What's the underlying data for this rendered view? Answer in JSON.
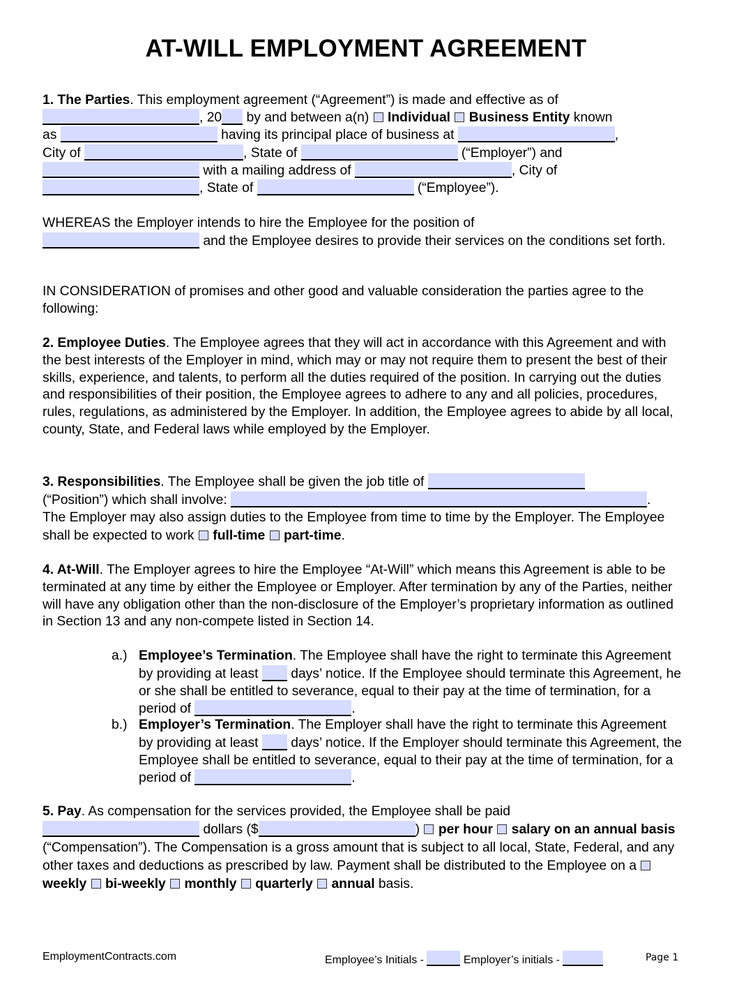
{
  "title": "AT-WILL EMPLOYMENT AGREEMENT",
  "s1": {
    "heading": "1. The Parties",
    "t1": ". This employment agreement (“Agreement”) is made and effective as of",
    "t2": ", 20",
    "t3": " by and between a(n) ",
    "opt_individual": "Individual",
    "opt_business": "Business Entity",
    "t4": " known",
    "t5": "as ",
    "t6": " having its principal place of business at ",
    "t7": ",",
    "t8": "City of ",
    "t9": ", State of ",
    "t10": " (“Employer”) and",
    "t11": " with a mailing address of ",
    "t12": ", City of",
    "t13": ", State of ",
    "t14": " (“Employee”)."
  },
  "whereas": {
    "t1": "WHEREAS the Employer intends to hire the Employee for the position of",
    "t2": " and the Employee desires to provide their services on the conditions set forth."
  },
  "consideration": "IN CONSIDERATION of promises and other good and valuable consideration the parties agree to the following:",
  "s2": {
    "heading": "2. Employee Duties",
    "text": ". The Employee agrees that they will act in accordance with this Agreement and with the best interests of the Employer in mind, which may or may not require them to present the best of their skills, experience, and talents, to perform all the duties required of the position. In carrying out the duties and responsibilities of their position, the Employee agrees to adhere to any and all policies, procedures, rules, regulations, as administered by the Employer. In addition, the Employee agrees to abide by all local, county, State, and Federal laws while employed by the Employer."
  },
  "s3": {
    "heading": "3. Responsibilities",
    "t1": ". The Employee shall be given the job title of ",
    "t2": "(“Position”) which shall involve: ",
    "t3": ".",
    "t4": "The Employer may also assign duties to the Employee from time to time by the Employer. The Employee shall be expected to work ",
    "opt_full": "full-time",
    "opt_part": "part-time",
    "t5": "."
  },
  "s4": {
    "heading": "4. At-Will",
    "text": ". The Employer agrees to hire the Employee “At-Will” which means this Agreement is able to be terminated at any time by either the Employee or Employer. After termination by any of the Parties, neither will have any obligation other than the non-disclosure of the Employer’s proprietary information as outlined in Section 13 and any non-compete listed in Section 14.",
    "a": {
      "label": "a.)",
      "heading": "Employee’s Termination",
      "t1": ". The Employee shall have the right to terminate this Agreement by providing at least ",
      "t2": " days’ notice. If the Employee should terminate this Agreement, he or she shall be entitled to severance, equal to their pay at the time of termination, for a period of ",
      "t3": "."
    },
    "b": {
      "label": "b.)",
      "heading": "Employer’s Termination",
      "t1": ". The Employer shall have the right to terminate this Agreement by providing at least ",
      "t2": " days’ notice. If the Employer should terminate this Agreement, the Employee shall be entitled to severance, equal to their pay at the time of termination, for a period of ",
      "t3": "."
    }
  },
  "s5": {
    "heading": "5. Pay",
    "t1": ". As compensation for the services provided, the Employee shall be paid",
    "t2": " dollars ($",
    "t3": ") ",
    "opt_hour": "per hour",
    "opt_salary": "salary on an annual basis",
    "t4": " (“Compensation”). The Compensation is a gross amount that is subject to all local, State, Federal, and any other taxes and deductions as prescribed by law. Payment shall be distributed to the Employee on a ",
    "opt_weekly": "weekly",
    "opt_biweekly": "bi-weekly",
    "opt_monthly": "monthly",
    "opt_quarterly": "quarterly",
    "opt_annual": "annual",
    "t5": " basis."
  },
  "footer": {
    "site": "EmploymentContracts.com",
    "employee_initials": "Employee’s Initials - ",
    "employer_initials": " Employer’s initials - ",
    "page": "Page 1"
  }
}
